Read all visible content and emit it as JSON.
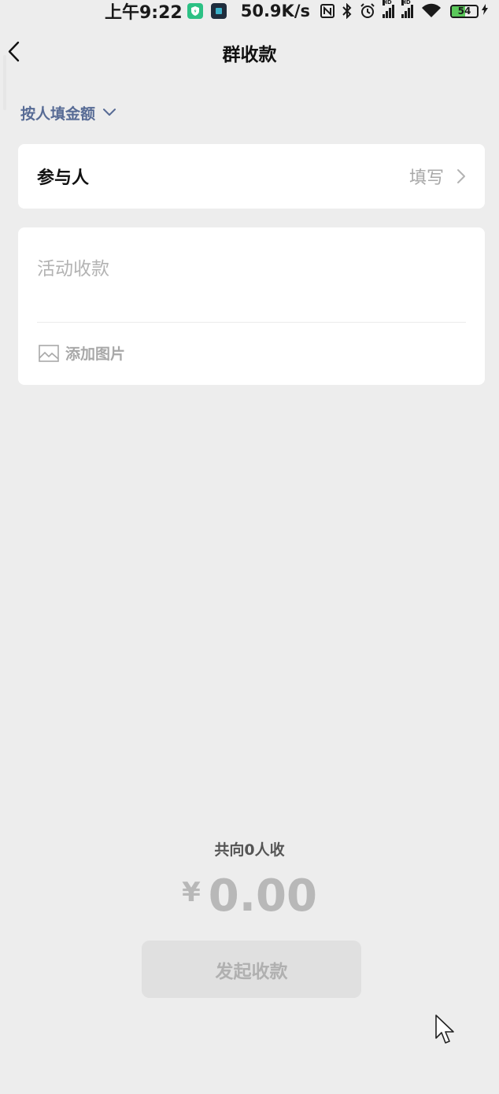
{
  "status_bar": {
    "time": "上午9:22",
    "network_speed": "50.9K/s",
    "battery_level": "54",
    "signal_badge_1": "HD",
    "signal_badge_2": "HD"
  },
  "nav": {
    "title": "群收款"
  },
  "mode": {
    "label": "按人填金额"
  },
  "participants": {
    "label": "参与人",
    "action": "填写"
  },
  "description": {
    "placeholder": "活动收款",
    "value": ""
  },
  "add_image": {
    "label": "添加图片"
  },
  "summary": {
    "text": "共向0人收",
    "currency": "¥",
    "amount": "0.00"
  },
  "submit": {
    "label": "发起收款"
  },
  "colors": {
    "background": "#ededed",
    "link_blue": "#576b95",
    "disabled_text": "#b0b0b0",
    "battery_fill": "#5ac85a"
  }
}
